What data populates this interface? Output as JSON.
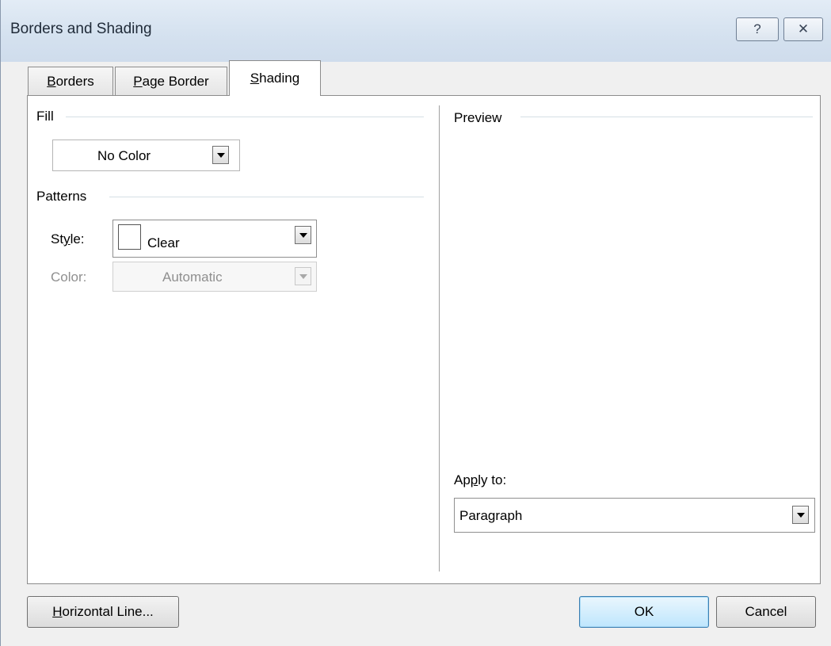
{
  "window": {
    "title": "Borders and Shading",
    "help_glyph": "?",
    "close_glyph": "✕"
  },
  "tabs": [
    {
      "key": "B",
      "rest": "orders",
      "active": false
    },
    {
      "key": "P",
      "rest": "age Border",
      "active": false
    },
    {
      "key": "S",
      "rest": "hading",
      "active": true
    }
  ],
  "fill": {
    "group_label": "Fill",
    "value": "No Color"
  },
  "patterns": {
    "group_label": "Patterns",
    "style_label_pre": "St",
    "style_label_key": "y",
    "style_label_post": "le:",
    "style_value": "Clear",
    "color_label": "Color:",
    "color_value": "Automatic"
  },
  "preview": {
    "group_label": "Preview",
    "apply_label_pre": "Ap",
    "apply_label_key": "p",
    "apply_label_post": "ly to:",
    "apply_value": "Paragraph"
  },
  "buttons": {
    "hline_key": "H",
    "hline_rest": "orizontal Line...",
    "ok": "OK",
    "cancel": "Cancel"
  }
}
